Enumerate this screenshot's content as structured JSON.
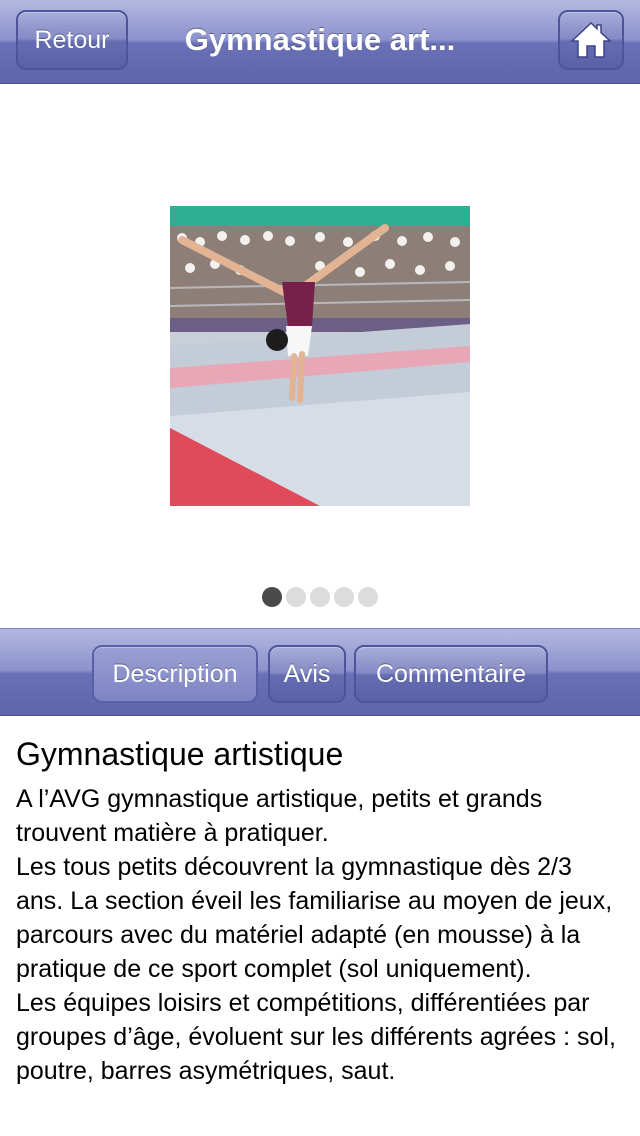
{
  "navbar": {
    "back_label": "Retour",
    "title": "Gymnastique art...",
    "home_icon": "home-icon"
  },
  "gallery": {
    "image_subject": "gymnast-handstand-photo",
    "page_count": 5,
    "current_page": 1
  },
  "tabs": [
    {
      "label": "Description",
      "selected": true
    },
    {
      "label": "Avis",
      "selected": false
    },
    {
      "label": "Commentaire",
      "selected": false
    }
  ],
  "content": {
    "heading": "Gymnastique artistique",
    "paragraphs": [
      "A l’AVG gymnastique artistique, petits et grands trouvent matière à pratiquer.",
      "Les tous petits découvrent la gymnastique dès 2/3 ans. La section éveil les familiarise au moyen de jeux, parcours avec du matériel adapté (en mousse) à la pratique de ce sport complet (sol uniquement).",
      "Les équipes loisirs et compétitions, différentiées par groupes d’âge, évoluent sur les différents agrées : sol, poutre, barres asymétriques, saut."
    ]
  },
  "colors": {
    "bar_top": "#b4b8e0",
    "bar_bottom": "#5d64aa",
    "dot_active": "#4a4a4a",
    "dot_inactive": "#dcdcdc"
  }
}
